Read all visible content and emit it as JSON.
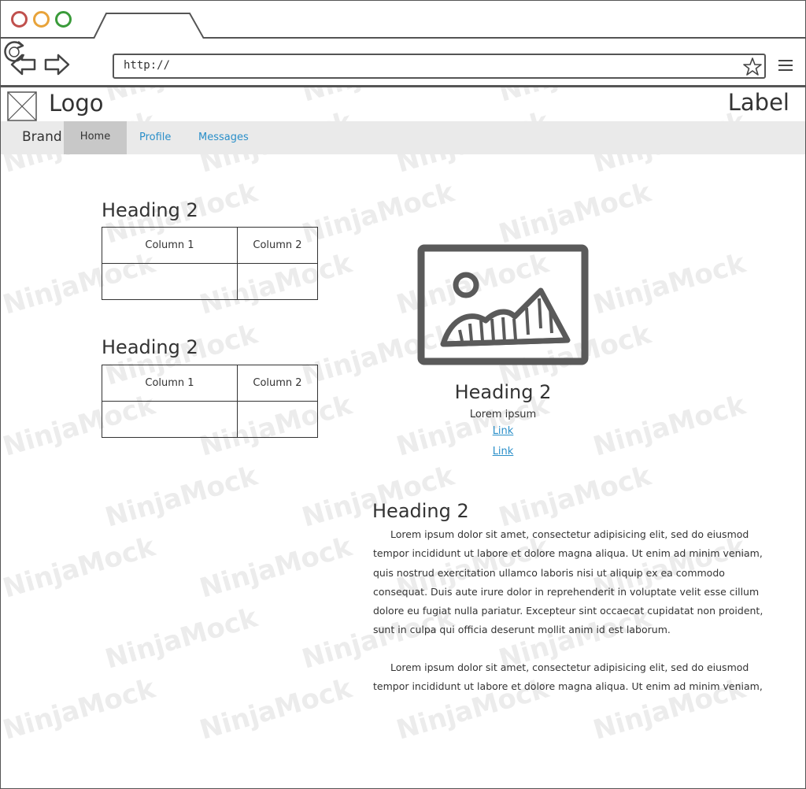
{
  "browser": {
    "url": "http://"
  },
  "watermark": {
    "text": "NinjaMock"
  },
  "header": {
    "logo": "Logo",
    "label": "Label"
  },
  "navbar": {
    "brand": "Brand",
    "items": [
      {
        "label": "Home",
        "active": true
      },
      {
        "label": "Profile",
        "active": false
      },
      {
        "label": "Messages",
        "active": false
      }
    ]
  },
  "tables": [
    {
      "heading": "Heading 2",
      "columns": [
        "Column 1",
        "Column 2"
      ],
      "rows": [
        [
          "",
          ""
        ]
      ]
    },
    {
      "heading": "Heading 2",
      "columns": [
        "Column 1",
        "Column 2"
      ],
      "rows": [
        [
          "",
          ""
        ]
      ]
    }
  ],
  "image_card": {
    "heading": "Heading 2",
    "text": "Lorem ipsum",
    "links": [
      "Link",
      "Link"
    ]
  },
  "text_section": {
    "heading": "Heading 2",
    "paragraphs": [
      "Lorem ipsum dolor sit amet, consectetur adipisicing elit, sed do eiusmod tempor incididunt ut labore et dolore magna aliqua. Ut enim ad minim veniam, quis nostrud exercitation ullamco laboris nisi ut aliquip ex ea commodo consequat. Duis aute irure dolor in reprehenderit in voluptate velit esse cillum dolore eu fugiat nulla pariatur. Excepteur sint occaecat cupidatat non proident, sunt in culpa qui officia deserunt mollit anim id est laborum.",
      "Lorem ipsum dolor sit amet, consectetur adipisicing elit, sed do eiusmod tempor incididunt ut labore et dolore magna aliqua. Ut enim ad minim veniam,"
    ]
  },
  "colors": {
    "link": "#2a8fc9",
    "nav_bg": "#eaeaea",
    "nav_active": "#c8c8c8",
    "close_dot": "#c0504d",
    "minimize_dot": "#e8a33a",
    "maximize_dot": "#3a9b3a"
  }
}
